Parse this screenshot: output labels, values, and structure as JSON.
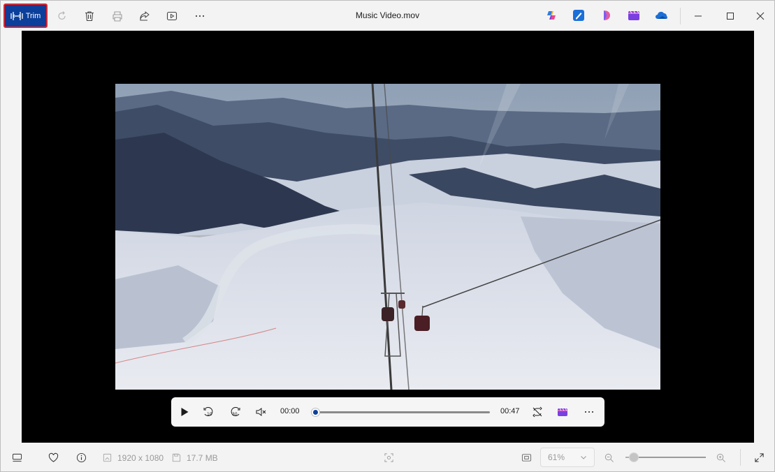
{
  "toolbar": {
    "trim_label": "Trim",
    "icons": [
      "trim-icon",
      "rotate-icon",
      "delete-icon",
      "print-icon",
      "share-icon",
      "slideshow-icon",
      "more-icon"
    ]
  },
  "window": {
    "title": "Music Video.mov",
    "apps": [
      "copilot-icon",
      "designer-icon",
      "clipchamp-icon",
      "clipchamp-film-icon",
      "onedrive-icon"
    ]
  },
  "player": {
    "current_time": "00:00",
    "duration": "00:47",
    "progress": 0.0
  },
  "statusbar": {
    "resolution": "1920 x 1080",
    "file_size": "17.7 MB",
    "zoom_value": "61%",
    "zoom_level": 0.1
  },
  "colors": {
    "accent": "#0b3f9b",
    "highlight_border": "#e0252b"
  }
}
